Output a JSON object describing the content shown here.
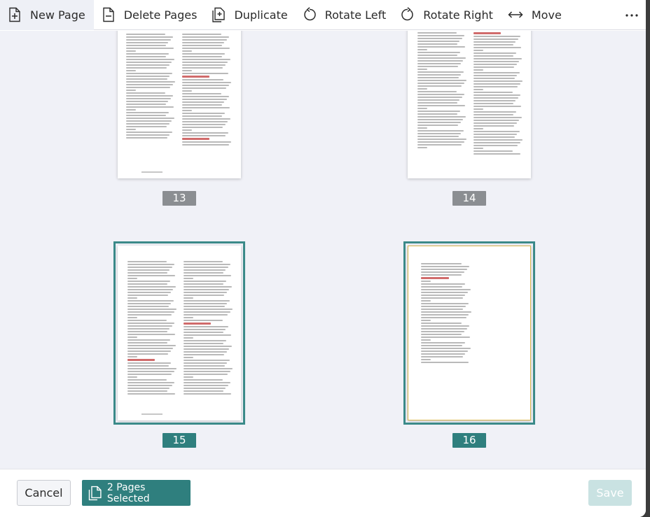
{
  "toolbar": {
    "new_page": "New Page",
    "delete_pages": "Delete Pages",
    "duplicate": "Duplicate",
    "rotate_left": "Rotate Left",
    "rotate_right": "Rotate Right",
    "move": "Move",
    "more_icon": "ellipsis-icon"
  },
  "pages": [
    {
      "number": "13",
      "selected": false
    },
    {
      "number": "14",
      "selected": false
    },
    {
      "number": "15",
      "selected": true
    },
    {
      "number": "16",
      "selected": true
    }
  ],
  "footer": {
    "cancel": "Cancel",
    "selected_label": "2 Pages Selected",
    "save": "Save"
  },
  "colors": {
    "accent": "#2f7f7e",
    "selection_outline": "#3b8a89",
    "page_number_gray": "#8b8e92",
    "save_disabled": "#c9e2e2"
  }
}
